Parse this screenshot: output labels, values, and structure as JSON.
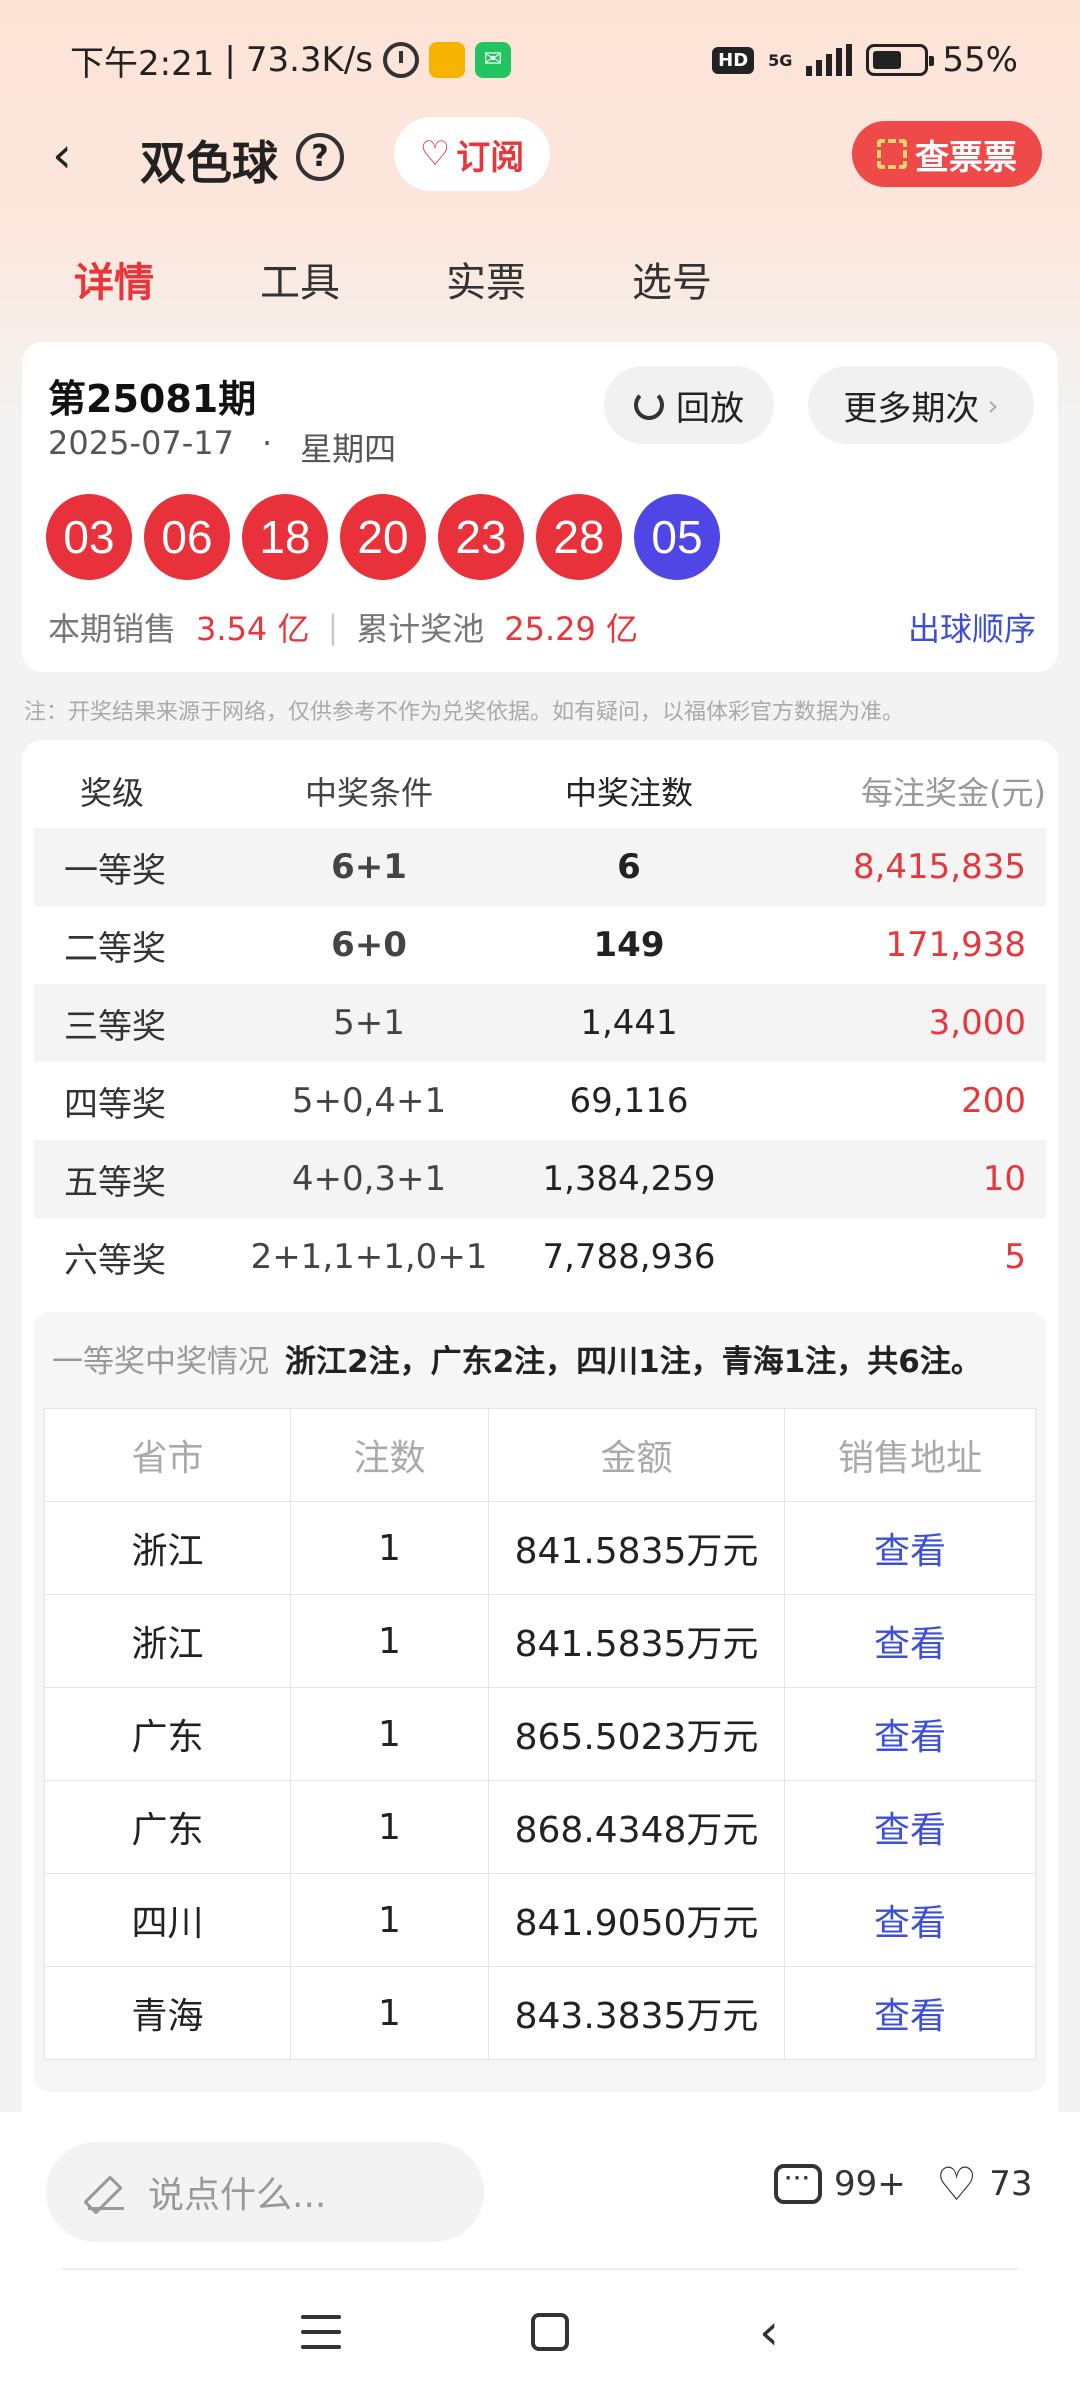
{
  "status": {
    "time": "下午2:21",
    "speed": "73.3K/s",
    "network": "5G",
    "battery": "55%"
  },
  "header": {
    "title": "双色球",
    "help_glyph": "?",
    "subscribe_label": "订阅",
    "check_ticket_label": "查票票"
  },
  "tabs": [
    {
      "label": "详情",
      "active": true
    },
    {
      "label": "工具",
      "active": false
    },
    {
      "label": "实票",
      "active": false
    },
    {
      "label": "选号",
      "active": false
    }
  ],
  "draw": {
    "issue": "第25081期",
    "date": "2025-07-17",
    "dot": "·",
    "weekday": "星期四",
    "replay_label": "回放",
    "more_label": "更多期次",
    "red_balls": [
      "03",
      "06",
      "18",
      "20",
      "23",
      "28"
    ],
    "blue_ball": "05",
    "sales_label": "本期销售",
    "sales_value": "3.54 亿",
    "pool_label": "累计奖池",
    "pool_value": "25.29 亿",
    "order_link": "出球顺序"
  },
  "note": "注：开奖结果来源于网络，仅供参考不作为兑奖依据。如有疑问，以福体彩官方数据为准。",
  "prize_table": {
    "headers": [
      "奖级",
      "中奖条件",
      "中奖注数",
      "每注奖金(元)"
    ],
    "rows": [
      {
        "level": "一等奖",
        "condition": "6+1",
        "count": "6",
        "amount": "8,415,835"
      },
      {
        "level": "二等奖",
        "condition": "6+0",
        "count": "149",
        "amount": "171,938"
      },
      {
        "level": "三等奖",
        "condition": "5+1",
        "count": "1,441",
        "amount": "3,000"
      },
      {
        "level": "四等奖",
        "condition": "5+0,4+1",
        "count": "69,116",
        "amount": "200"
      },
      {
        "level": "五等奖",
        "condition": "4+0,3+1",
        "count": "1,384,259",
        "amount": "10"
      },
      {
        "level": "六等奖",
        "condition": "2+1,1+1,0+1",
        "count": "7,788,936",
        "amount": "5"
      }
    ]
  },
  "first_prize": {
    "label": "一等奖中奖情况",
    "summary": "浙江2注，广东2注，四川1注，青海1注，共6注。",
    "headers": [
      "省市",
      "注数",
      "金额",
      "销售地址"
    ],
    "rows": [
      {
        "province": "浙江",
        "count": "1",
        "amount": "841.5835万元",
        "link": "查看"
      },
      {
        "province": "浙江",
        "count": "1",
        "amount": "841.5835万元",
        "link": "查看"
      },
      {
        "province": "广东",
        "count": "1",
        "amount": "865.5023万元",
        "link": "查看"
      },
      {
        "province": "广东",
        "count": "1",
        "amount": "868.4348万元",
        "link": "查看"
      },
      {
        "province": "四川",
        "count": "1",
        "amount": "841.9050万元",
        "link": "查看"
      },
      {
        "province": "青海",
        "count": "1",
        "amount": "843.3835万元",
        "link": "查看"
      }
    ]
  },
  "bottom": {
    "comment_placeholder": "说点什么...",
    "comment_count": "99+",
    "like_count": "73"
  },
  "colors": {
    "accent_red": "#e8363b",
    "ball_red": "#e8313a",
    "ball_blue": "#4f46e5",
    "link_blue": "#3b4fd8"
  },
  "icons": [
    "alarm-icon",
    "app-icon",
    "wechat-icon",
    "hd-icon",
    "signal-icon",
    "battery-icon",
    "back-icon",
    "help-icon",
    "heart-plus-icon",
    "scan-icon",
    "replay-icon",
    "chevron-right-icon",
    "pencil-icon",
    "comment-icon",
    "heart-icon",
    "menu-icon",
    "home-icon",
    "nav-back-icon"
  ]
}
